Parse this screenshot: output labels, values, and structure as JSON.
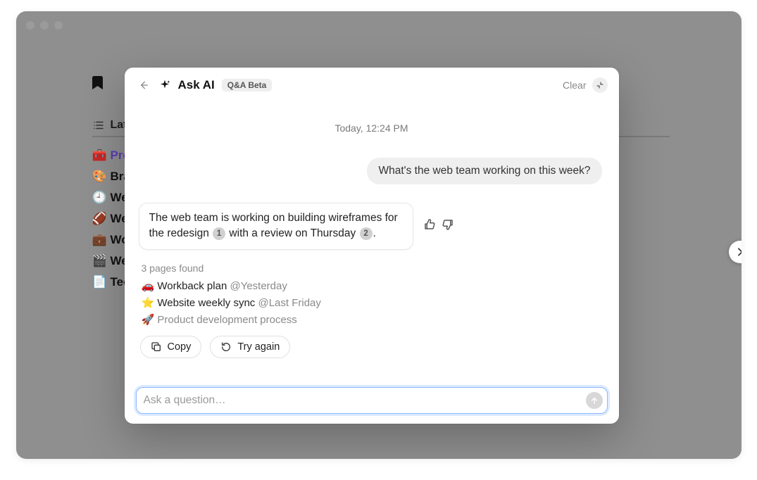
{
  "background": {
    "tab_label": "Lat",
    "items": [
      {
        "emoji": "🧰",
        "label": "Pro",
        "color": "#5b3db3"
      },
      {
        "emoji": "🎨",
        "label": "Bra",
        "color": "#111"
      },
      {
        "emoji": "🕘",
        "label": "We",
        "color": "#111"
      },
      {
        "emoji": "🏈",
        "label": "We",
        "color": "#111"
      },
      {
        "emoji": "💼",
        "label": "Wo",
        "color": "#111"
      },
      {
        "emoji": "🎬",
        "label": "We",
        "color": "#111"
      },
      {
        "emoji": "📄",
        "label": "Tec",
        "color": "#111"
      }
    ]
  },
  "modal": {
    "title": "Ask AI",
    "badge": "Q&A Beta",
    "clear": "Clear",
    "timestamp": "Today, 12:24 PM",
    "user_message": "What's the web team working on this week?",
    "ai_answer": {
      "part1": "The web team is working on building wireframes for the redesign ",
      "cite1": "1",
      "part2": " with a review on Thursday ",
      "cite2": "2",
      "part3": "."
    },
    "sources_header": "3 pages found",
    "sources": [
      {
        "emoji": "🚗",
        "title": "Workback plan",
        "time": "@Yesterday",
        "muted": false
      },
      {
        "emoji": "⭐",
        "title": "Website weekly sync",
        "time": "@Last Friday",
        "muted": false
      },
      {
        "emoji": "🚀",
        "title": "Product development process",
        "time": "",
        "muted": true
      }
    ],
    "copy_label": "Copy",
    "try_again_label": "Try again",
    "input_placeholder": "Ask a question…"
  }
}
